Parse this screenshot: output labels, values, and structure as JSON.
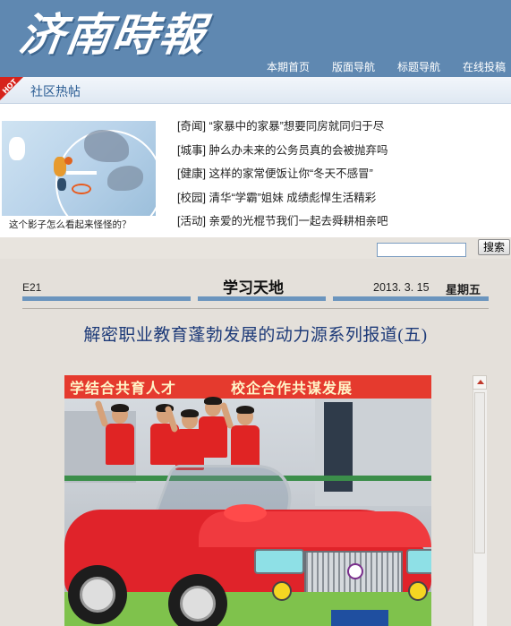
{
  "header": {
    "logo_text": "济南時報",
    "nav": [
      "本期首页",
      "版面导航",
      "标题导航",
      "在线投稿"
    ]
  },
  "hot_section": {
    "badge": "HOT",
    "title": "社区热帖",
    "photo_caption": "这个影子怎么看起来怪怪的？",
    "posts": [
      {
        "tag": "[奇闻]",
        "text": "“家暴中的家暴”想要同房就同归于尽"
      },
      {
        "tag": "[城事]",
        "text": "肿么办未来的公务员真的会被抛弃吗"
      },
      {
        "tag": "[健康]",
        "text": "这样的家常便饭让你“冬天不感冒”"
      },
      {
        "tag": "[校园]",
        "text": "清华“学霸”姐妹 成绩彪悍生活精彩"
      },
      {
        "tag": "[活动]",
        "text": "亲爱的光棍节我们一起去舜耕相亲吧"
      }
    ]
  },
  "search": {
    "placeholder": "",
    "button_label": "搜索"
  },
  "page_header": {
    "page_no": "E21",
    "section_title": "学习天地",
    "date": "2013. 3. 15",
    "weekday": "星期五"
  },
  "article": {
    "headline": "解密职业教育蓬勃发展的动力源系列报道(五)",
    "banner_left": "学结合共育人才",
    "banner_right": "校企合作共谋发展"
  },
  "colors": {
    "header_blue": "#5f88b1",
    "headline_blue": "#1d3a78",
    "rule_blue": "#6b95be",
    "page_bg": "#e4e0da"
  }
}
